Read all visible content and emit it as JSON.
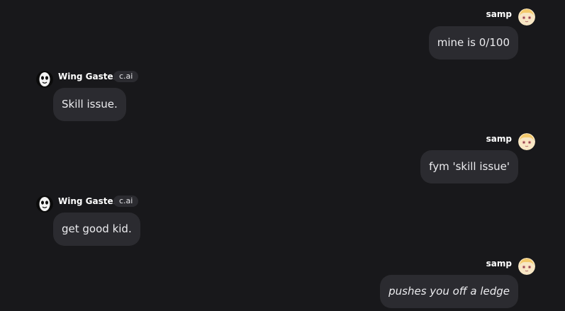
{
  "messages": [
    {
      "author": "samp",
      "side": "right",
      "text": "mine is 0/100",
      "italic": false,
      "avatar": "samp-avatar-icon"
    },
    {
      "author": "Wing Gaster",
      "badge": "c.ai",
      "side": "left",
      "text": "Skill issue.",
      "italic": false,
      "avatar": "gaster-avatar-icon"
    },
    {
      "author": "samp",
      "side": "right",
      "text": "fym 'skill issue'",
      "italic": false,
      "avatar": "samp-avatar-icon"
    },
    {
      "author": "Wing Gaster",
      "badge": "c.ai",
      "side": "left",
      "text": "get good kid.",
      "italic": false,
      "avatar": "gaster-avatar-icon"
    },
    {
      "author": "samp",
      "side": "right",
      "text": "pushes you off a ledge",
      "italic": true,
      "avatar": "samp-avatar-icon"
    }
  ],
  "colors": {
    "background": "#18181b",
    "bubble": "#2b2b30",
    "text": "#ececef"
  }
}
